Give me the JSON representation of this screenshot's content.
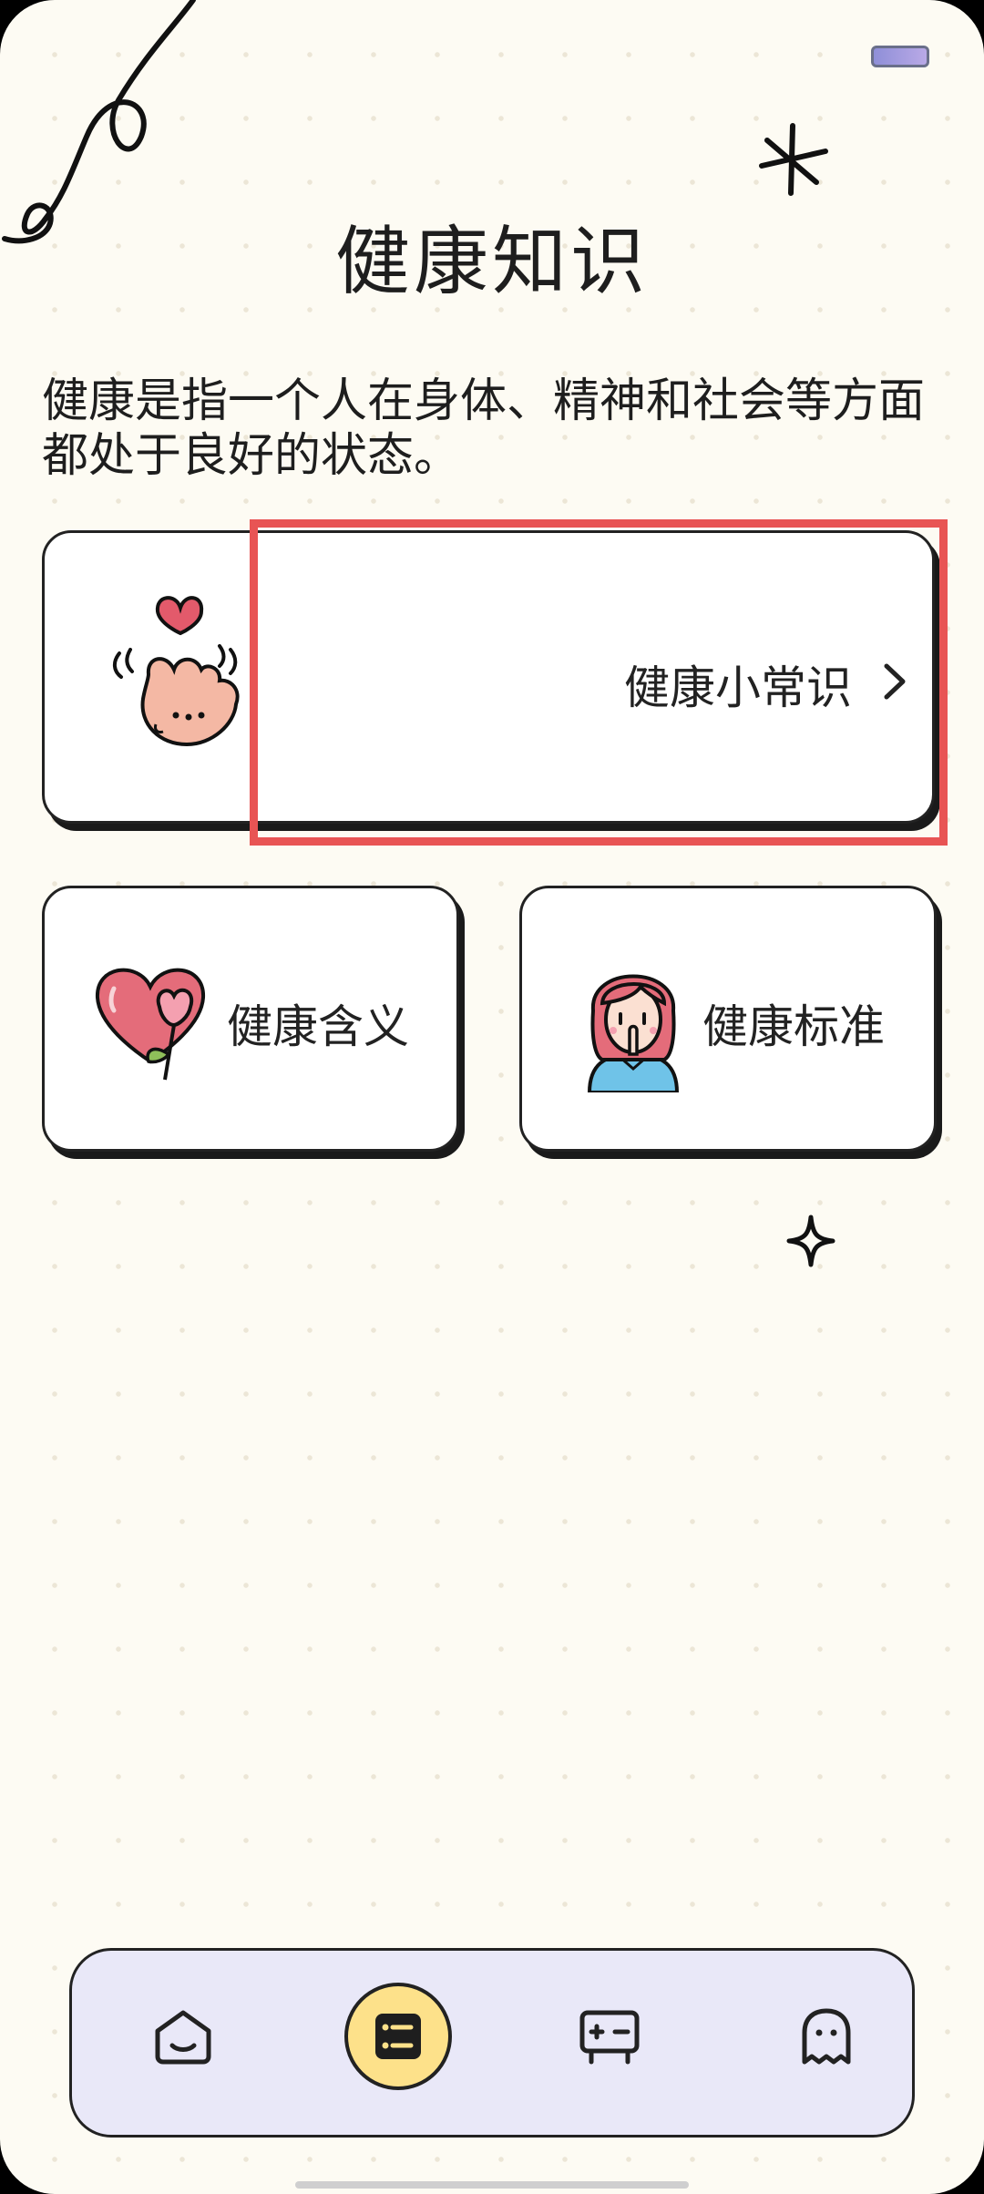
{
  "header": {
    "title": "健康知识"
  },
  "intro": {
    "text": "健康是指一个人在身体、精神和社会等方面都处于良好的状态。"
  },
  "cards": {
    "tips": {
      "label": "健康小常识",
      "icon": "finger-heart-icon"
    },
    "meaning": {
      "label": "健康含义",
      "icon": "heart-flower-icon"
    },
    "standard": {
      "label": "健康标准",
      "icon": "girl-icon"
    }
  },
  "tabbar": {
    "items": [
      {
        "icon": "home-icon",
        "active": false
      },
      {
        "icon": "list-icon",
        "active": true
      },
      {
        "icon": "calculator-icon",
        "active": false
      },
      {
        "icon": "ghost-icon",
        "active": false
      }
    ],
    "active_color": "#fde18a",
    "background": "#e9e8f8"
  },
  "colors": {
    "background": "#fdfbf3",
    "highlight": "#e85454",
    "accent_pink": "#e46c7a"
  }
}
